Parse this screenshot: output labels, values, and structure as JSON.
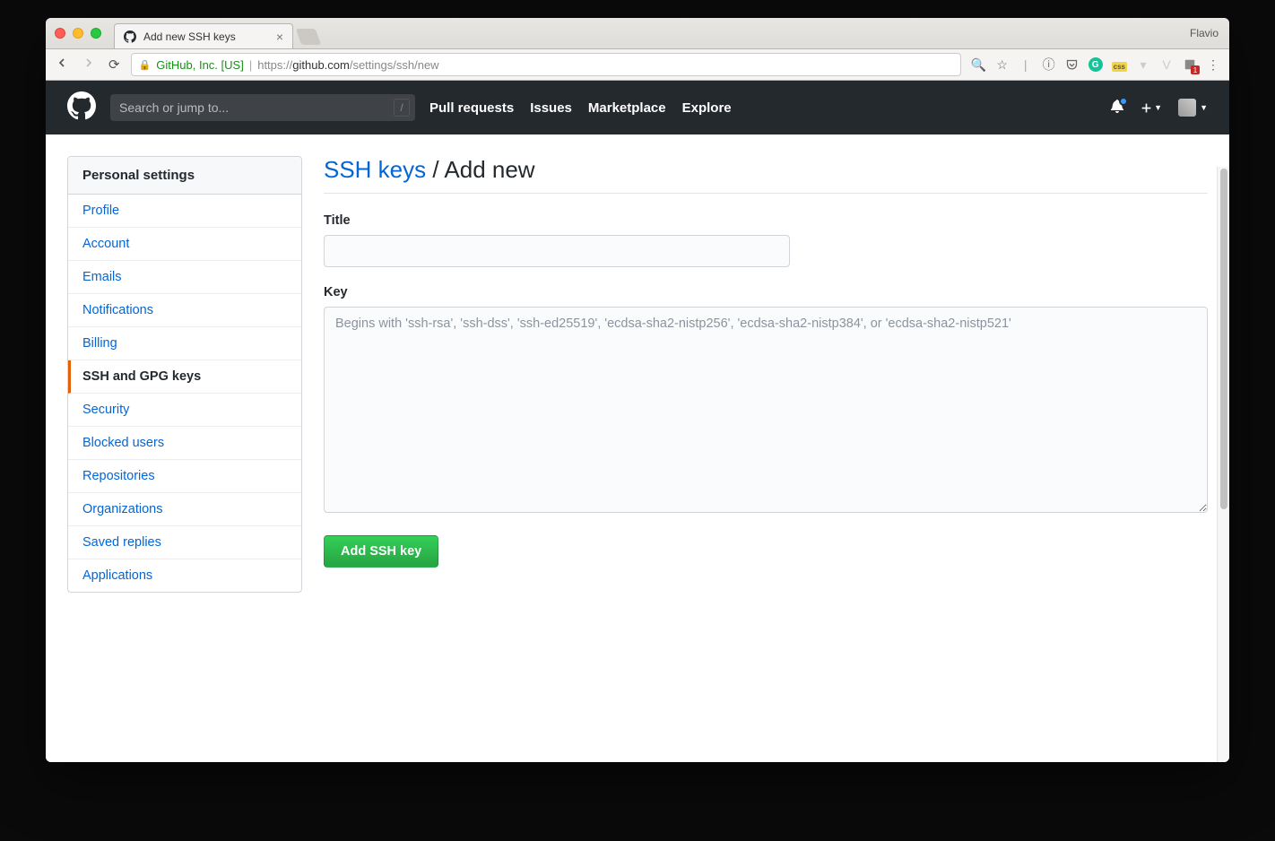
{
  "browser": {
    "tab_title": "Add new SSH keys",
    "profile": "Flavio",
    "url_org": "GitHub, Inc. [US]",
    "url_scheme": "https://",
    "url_host": "github.com",
    "url_path": "/settings/ssh/new"
  },
  "gh_header": {
    "search_placeholder": "Search or jump to...",
    "search_key": "/",
    "nav": [
      "Pull requests",
      "Issues",
      "Marketplace",
      "Explore"
    ]
  },
  "sidebar": {
    "heading": "Personal settings",
    "items": [
      {
        "label": "Profile",
        "active": false
      },
      {
        "label": "Account",
        "active": false
      },
      {
        "label": "Emails",
        "active": false
      },
      {
        "label": "Notifications",
        "active": false
      },
      {
        "label": "Billing",
        "active": false
      },
      {
        "label": "SSH and GPG keys",
        "active": true
      },
      {
        "label": "Security",
        "active": false
      },
      {
        "label": "Blocked users",
        "active": false
      },
      {
        "label": "Repositories",
        "active": false
      },
      {
        "label": "Organizations",
        "active": false
      },
      {
        "label": "Saved replies",
        "active": false
      },
      {
        "label": "Applications",
        "active": false
      }
    ]
  },
  "main": {
    "breadcrumb_link": "SSH keys",
    "breadcrumb_sep": " / ",
    "breadcrumb_current": "Add new",
    "title_label": "Title",
    "title_value": "",
    "key_label": "Key",
    "key_placeholder": "Begins with 'ssh-rsa', 'ssh-dss', 'ssh-ed25519', 'ecdsa-sha2-nistp256', 'ecdsa-sha2-nistp384', or 'ecdsa-sha2-nistp521'",
    "key_value": "",
    "submit_label": "Add SSH key"
  },
  "ext_badge": "1"
}
